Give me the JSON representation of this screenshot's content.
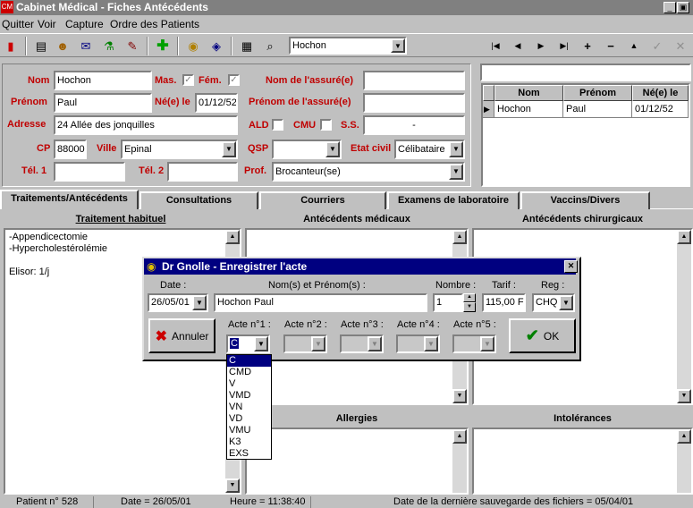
{
  "window": {
    "title": "Cabinet Médical - Fiches Antécédents",
    "minimize": "_",
    "restore": "▣"
  },
  "menu": {
    "items": [
      "Quitter",
      "Voir",
      "Capture",
      "Ordre des Patients"
    ]
  },
  "toolbar": {
    "patient_select": "Hochon",
    "nav": [
      "|◀",
      "◀",
      "▶",
      "▶|",
      "+",
      "−",
      "▲",
      "✓",
      "✕"
    ]
  },
  "patient": {
    "labels": {
      "nom": "Nom",
      "prenom": "Prénom",
      "adresse": "Adresse",
      "cp": "CP",
      "ville": "Ville",
      "tel1": "Tél. 1",
      "tel2": "Tél. 2",
      "mas": "Mas.",
      "fem": "Fém.",
      "nele": "Né(e) le",
      "ald": "ALD",
      "cmu": "CMU",
      "ss": "S.S.",
      "qsp": "QSP",
      "prof": "Prof.",
      "nom_assure": "Nom de l'assuré(e)",
      "prenom_assure": "Prénom de l'assuré(e)",
      "etat_civil": "Etat civil"
    },
    "values": {
      "nom": "Hochon",
      "prenom": "Paul",
      "adresse": "24 Allée des jonquilles",
      "cp": "88000",
      "ville": "Epinal",
      "tel1": "",
      "tel2": "",
      "nele": "01/12/52",
      "ss": "-",
      "qsp": "",
      "prof": "Brocanteur(se)",
      "nom_assure": "",
      "prenom_assure": "",
      "etat_civil": "Célibataire"
    }
  },
  "grid": {
    "headers": [
      "Nom",
      "Prénom",
      "Né(e) le"
    ],
    "rows": [
      [
        "Hochon",
        "Paul",
        "01/12/52"
      ]
    ]
  },
  "tabs": [
    "Traitements/Antécédents",
    "Consultations",
    "Courriers",
    "Examens de laboratoire",
    "Vaccins/Divers"
  ],
  "sections": {
    "traitement": "Traitement habituel",
    "antecedents_medicaux": "Antécédents médicaux",
    "antecedents_chirurgicaux": "Antécédents chirurgicaux",
    "allergies": "Allergies",
    "intolerances": "Intolérances"
  },
  "traitement_text": [
    "-Appendicectomie",
    "-Hypercholestérolémie",
    "",
    "Elisor: 1/j"
  ],
  "dialog": {
    "title": "Dr Gnolle - Enregistrer l'acte",
    "labels": {
      "date": "Date :",
      "nom": "Nom(s) et Prénom(s) :",
      "nombre": "Nombre :",
      "tarif": "Tarif :",
      "reg": "Reg :",
      "acte1": "Acte n°1 :",
      "acte2": "Acte n°2 :",
      "acte3": "Acte n°3 :",
      "acte4": "Acte n°4 :",
      "acte5": "Acte n°5 :"
    },
    "values": {
      "date": "26/05/01",
      "nom": "Hochon Paul",
      "nombre": "1",
      "tarif": "115,00 F",
      "reg": "CHQ",
      "acte1": "C"
    },
    "annuler": "Annuler",
    "ok": "OK",
    "acte_options": [
      "C",
      "CMD",
      "V",
      "VMD",
      "VN",
      "VD",
      "VMU",
      "K3",
      "EXS"
    ]
  },
  "status": {
    "patient": "Patient n° 528",
    "date": "Date = 26/05/01",
    "heure": "Heure = 11:38:40",
    "sauvegarde": "Date de la dernière sauvegarde des fichiers = 05/04/01"
  }
}
